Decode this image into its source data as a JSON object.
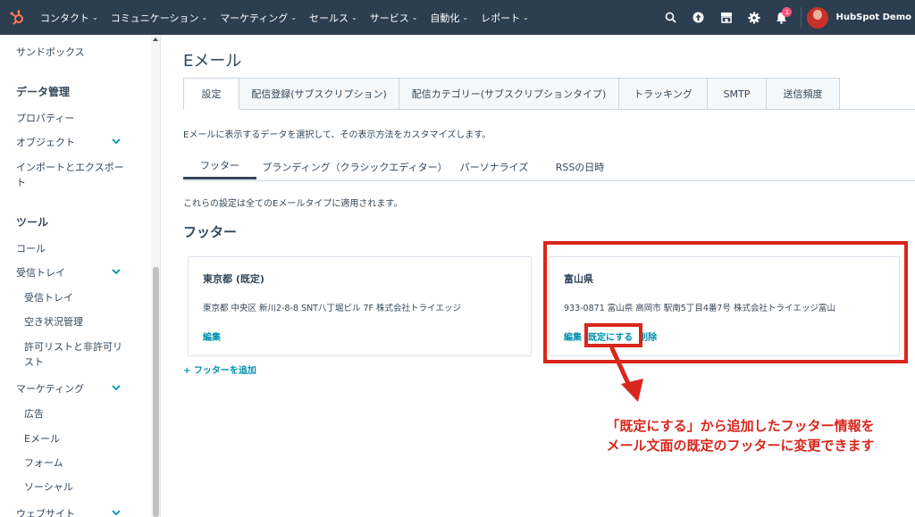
{
  "colors": {
    "nav_bg": "#2d3e50",
    "accent": "#0091ae",
    "highlight": "#d9261c",
    "logo": "#ff7a59"
  },
  "topnav": {
    "items": [
      "コンタクト",
      "コミュニケーション",
      "マーケティング",
      "セールス",
      "サービス",
      "自動化",
      "レポート"
    ],
    "icons": [
      "search-icon",
      "upgrade-icon",
      "marketplace-icon",
      "settings-icon",
      "notifications-icon"
    ],
    "notification_count": "1",
    "account_name": "HubSpot Demo"
  },
  "sidebar": {
    "sandbox": "サンドボックス",
    "data_mgmt": "データ管理",
    "properties": "プロパティー",
    "objects": "オブジェクト",
    "import_export_1": "インポートとエクスポー",
    "import_export_2": "ト",
    "tools": "ツール",
    "calls": "コール",
    "inbox": "受信トレイ",
    "inbox_sub": "受信トレイ",
    "availability": "空き状況管理",
    "allowlist_1": "許可リストと非許可リ",
    "allowlist_2": "スト",
    "marketing": "マーケティング",
    "ads": "広告",
    "email": "Eメール",
    "forms": "フォーム",
    "social": "ソーシャル",
    "website": "ウェブサイト"
  },
  "main": {
    "title": "Eメール",
    "tabs": [
      "設定",
      "配信登録(サブスクリプション)",
      "配信カテゴリー(サブスクリプションタイプ)",
      "トラッキング",
      "SMTP",
      "送信頻度"
    ],
    "description": "Eメールに表示するデータを選択して、その表示方法をカスタマイズします。",
    "subtabs": [
      "フッター",
      "ブランディング（クラシックエディター）",
      "パーソナライズ",
      "RSSの日時"
    ],
    "note": "これらの設定は全てのEメールタイプに適用されます。",
    "section_title": "フッター",
    "cards": [
      {
        "title": "東京都 (既定)",
        "address": "東京都 中央区 新川2-8-8 SNT八丁堀ビル 7F 株式会社トライエッジ",
        "edit": "編集"
      },
      {
        "title": "富山県",
        "address": "933-0871 富山県 高岡市 駅南5丁目4番7号 株式会社トライエッジ富山",
        "edit": "編集",
        "set_default": "既定にする",
        "delete": "削除"
      }
    ],
    "add_footer": "+ フッターを追加"
  },
  "callout": {
    "line1": "「既定にする」から追加したフッター情報を",
    "line2": "メール文面の既定のフッターに変更できます"
  }
}
